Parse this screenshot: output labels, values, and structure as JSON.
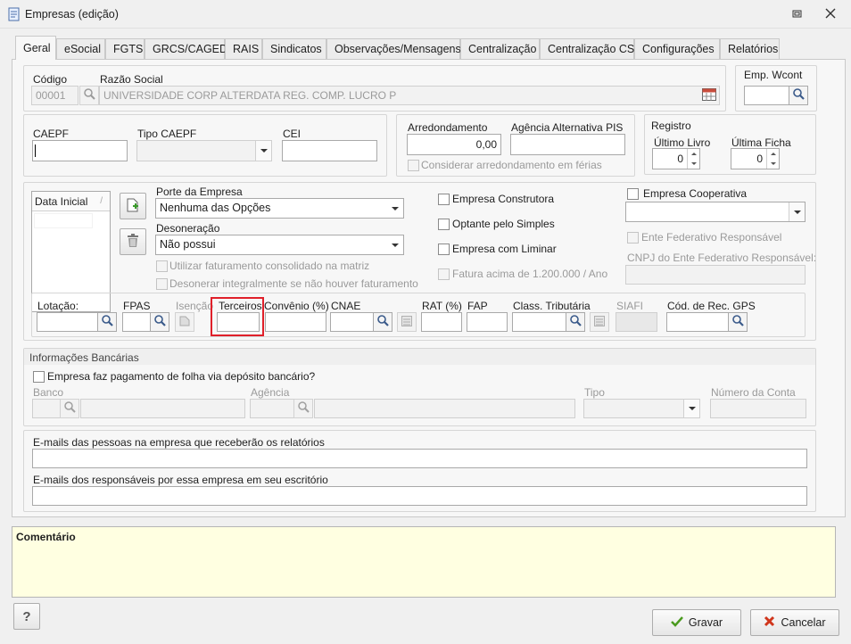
{
  "window": {
    "title": "Empresas (edição)"
  },
  "tabs": [
    "Geral",
    "eSocial",
    "FGTS",
    "GRCS/CAGED",
    "RAIS",
    "Sindicatos",
    "Observações/Mensagens",
    "Centralização",
    "Centralização CS",
    "Configurações",
    "Relatórios"
  ],
  "empresa": {
    "codigo_label": "Código",
    "codigo_value": "00001",
    "razao_label": "Razão Social",
    "razao_value": "UNIVERSIDADE CORP ALTERDATA REG. COMP. LUCRO P",
    "wcont_label": "Emp. Wcont",
    "wcont_value": ""
  },
  "caepf": {
    "caepf_label": "CAEPF",
    "tipo_label": "Tipo CAEPF",
    "cei_label": "CEI"
  },
  "arred": {
    "arred_label": "Arredondamento",
    "arred_value": "0,00",
    "agencia_label": "Agência Alternativa PIS",
    "ferias_label": "Considerar arredondamento em férias"
  },
  "registro": {
    "title": "Registro",
    "livro_label": "Último Livro",
    "livro_value": "0",
    "ficha_label": "Última Ficha",
    "ficha_value": "0"
  },
  "porte": {
    "grid_header": "Data Inicial",
    "porte_label": "Porte da Empresa",
    "porte_value": "Nenhuma das Opções",
    "deson_label": "Desoneração",
    "deson_value": "Não possui",
    "fat_consolidado": "Utilizar faturamento consolidado na matriz",
    "deson_integral": "Desonerar integralmente se não houver faturamento"
  },
  "flags": {
    "construtora": "Empresa Construtora",
    "simples": "Optante pelo Simples",
    "liminar": "Empresa com Liminar",
    "fatura": "Fatura acima de 1.200.000 / Ano",
    "cooperativa": "Empresa Cooperativa",
    "ente_federativo": "Ente Federativo Responsável",
    "cnpj_ente": "CNPJ do Ente Federativo Responsável:"
  },
  "lotacao": {
    "lotacao": "Lotação:",
    "fpas": "FPAS",
    "isencao": "Isenção",
    "terceiros": "Terceiros",
    "convenio": "Convênio (%)",
    "cnae": "CNAE",
    "rat": "RAT (%)",
    "fap": "FAP",
    "class_trib": "Class. Tributária",
    "siafi": "SIAFI",
    "cod_gps": "Cód. de Rec. GPS"
  },
  "bancarias": {
    "title": "Informações Bancárias",
    "deposito": "Empresa faz pagamento de folha via depósito bancário?",
    "banco": "Banco",
    "agencia": "Agência",
    "tipo": "Tipo",
    "conta": "Número da Conta"
  },
  "emails": {
    "relatorios": "E-mails das pessoas na empresa que receberão os relatórios",
    "responsaveis": "E-mails dos responsáveis por essa empresa em seu escritório"
  },
  "comentario": {
    "label": "Comentário"
  },
  "buttons": {
    "help": "?",
    "gravar": "Gravar",
    "cancelar": "Cancelar"
  },
  "colors": {
    "comment_bg": "#ffffe1",
    "highlight": "#e0202a"
  }
}
